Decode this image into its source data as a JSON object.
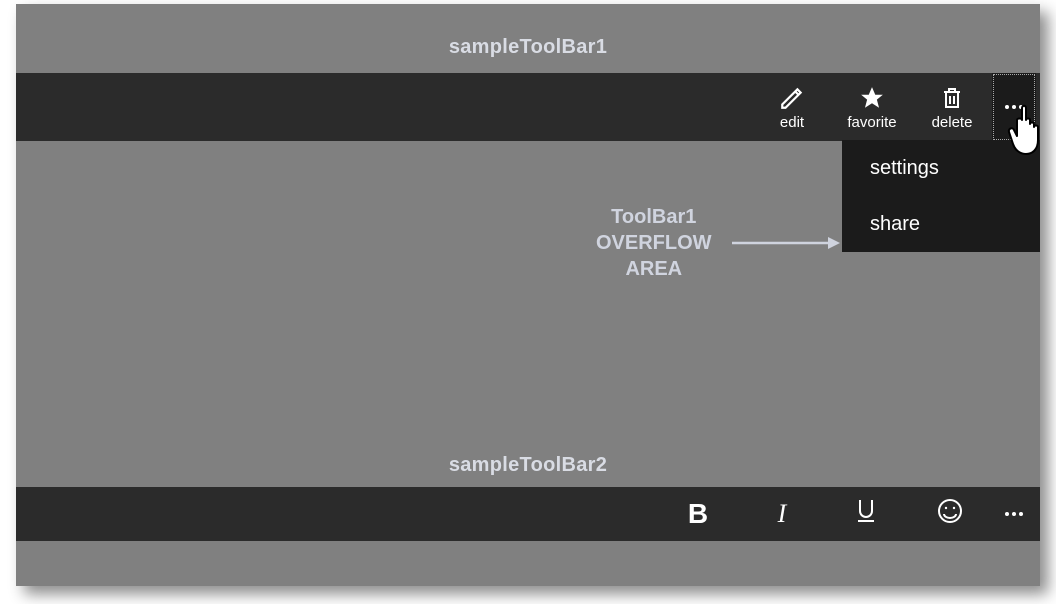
{
  "titles": {
    "toolbar1": "sampleToolBar1",
    "toolbar2": "sampleToolBar2"
  },
  "toolbar1": {
    "items": [
      {
        "icon": "edit-icon",
        "label": "edit"
      },
      {
        "icon": "star-icon",
        "label": "favorite"
      },
      {
        "icon": "trash-icon",
        "label": "delete"
      }
    ],
    "more_icon": "more-icon"
  },
  "overflow": {
    "items": [
      {
        "label": "settings"
      },
      {
        "label": "share"
      }
    ]
  },
  "annotation": {
    "text": "ToolBar1\nOVERFLOW\nAREA",
    "arrow_icon": "arrow-right-icon"
  },
  "toolbar2": {
    "items": [
      {
        "icon": "bold-icon",
        "glyph": "B"
      },
      {
        "icon": "italic-icon",
        "glyph": "I"
      },
      {
        "icon": "underline-icon",
        "glyph": "U"
      },
      {
        "icon": "emoticon-icon",
        "glyph": "☺"
      }
    ],
    "more_icon": "more-icon"
  }
}
